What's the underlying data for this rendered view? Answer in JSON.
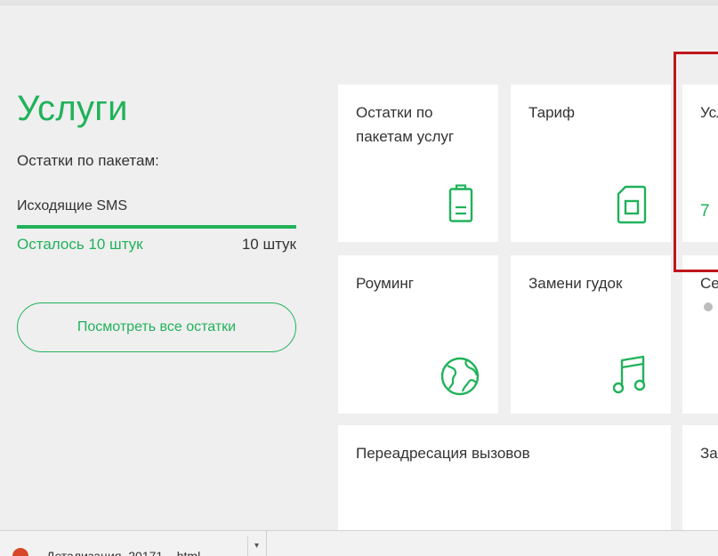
{
  "services": {
    "title": "Услуги",
    "subtitle": "Остатки по пакетам:",
    "package_name": "Исходящие SMS",
    "remaining_label": "Осталось 10 штук",
    "total_label": "10 штук",
    "remaining_fraction": 1.0,
    "view_all_button": "Посмотреть все остатки"
  },
  "tiles": [
    {
      "label": "Остатки по пакетам услуг",
      "icon": "battery-icon"
    },
    {
      "label": "Тариф",
      "icon": "sim-card-icon"
    },
    {
      "label": "Усл",
      "partial_value": "7"
    },
    {
      "label": "Роуминг",
      "icon": "globe-icon"
    },
    {
      "label": "Замени гудок",
      "icon": "music-note-icon"
    },
    {
      "label": "Се"
    },
    {
      "label": "Переадресация вызовов"
    },
    {
      "label": "За"
    }
  ],
  "download_bar": {
    "file_name": "Детализация_20171....html",
    "arrow": "▾"
  },
  "colors": {
    "accent": "#20b25a",
    "highlight": "#c0161c",
    "background": "#efefef",
    "tile": "#ffffff"
  }
}
